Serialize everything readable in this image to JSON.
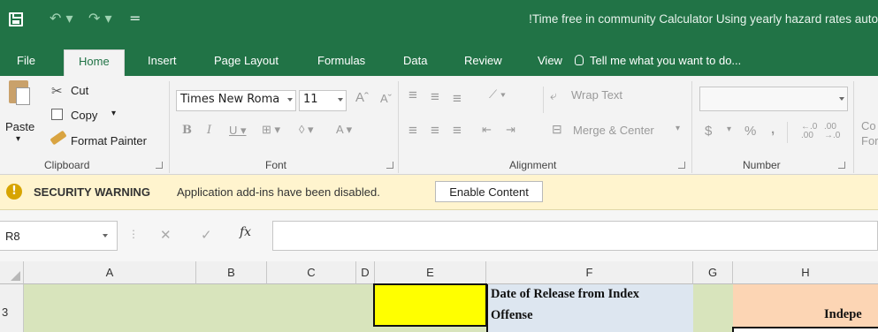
{
  "titlebar": {
    "title": "!Time free in community Calculator Using yearly hazard rates auto",
    "undo_glyph": "↶ ▾",
    "redo_glyph": "↷ ▾",
    "customize_glyph": "="
  },
  "tabs": [
    {
      "label": "File"
    },
    {
      "label": "Home"
    },
    {
      "label": "Insert"
    },
    {
      "label": "Page Layout"
    },
    {
      "label": "Formulas"
    },
    {
      "label": "Data"
    },
    {
      "label": "Review"
    },
    {
      "label": "View"
    }
  ],
  "tell_me": "Tell me what you want to do...",
  "ribbon": {
    "clipboard": {
      "label": "Clipboard",
      "paste": "Paste",
      "cut": "Cut",
      "copy": "Copy",
      "format_painter": "Format Painter"
    },
    "font": {
      "label": "Font",
      "name": "Times New Roma",
      "size": "11"
    },
    "alignment": {
      "label": "Alignment",
      "wrap_text": "Wrap Text",
      "merge_center": "Merge & Center"
    },
    "number": {
      "label": "Number",
      "format": "",
      "currency": "$",
      "percent": "%",
      "comma": ","
    },
    "styles_partial": "Co\nFor"
  },
  "security": {
    "title": "SECURITY WARNING",
    "message": "Application add-ins have been disabled.",
    "button": "Enable Content"
  },
  "formula_bar": {
    "name_box": "R8",
    "fx": "fx",
    "formula": ""
  },
  "grid": {
    "columns": [
      "A",
      "B",
      "C",
      "D",
      "E",
      "F",
      "G",
      "H"
    ],
    "visible_row": "3",
    "cells": {
      "F3_line1": "Date of Release from Index",
      "F3_line2": "Offense",
      "H3": "Indepe"
    },
    "colors": {
      "green_fill": "#d8e4bc",
      "yellow_fill": "#ffff00",
      "blue_fill": "#dde6f0",
      "peach_fill": "#fcd5b4"
    }
  }
}
